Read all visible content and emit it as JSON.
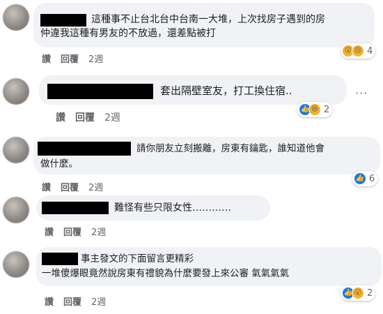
{
  "comments": [
    {
      "text_line1": "這種事不止台北台中台南一大堆，上次找房子遇到的房",
      "text_line2": "仲違我這種有男友的不放過，還差點被打",
      "like_label": "讚",
      "reply_label": "回覆",
      "time": "2週",
      "reaction_count": "4",
      "reactions": [
        "wow-icon",
        "sad-icon"
      ]
    },
    {
      "text_line1": "套出隔壁室友，打工換住宿..",
      "like_label": "讚",
      "reply_label": "回覆",
      "time": "2週",
      "reaction_count": "2",
      "reactions": [
        "like-icon",
        "haha-icon"
      ]
    },
    {
      "text_line1": "請你朋友立刻搬離，房東有鑰匙，誰知道他會",
      "text_line2": "做什麼。",
      "like_label": "讚",
      "reply_label": "回覆",
      "time": "2週",
      "reaction_count": "6",
      "reactions": [
        "like-icon"
      ]
    },
    {
      "text_line1": "難怪有些只限女性…………",
      "like_label": "讚",
      "reply_label": "回覆",
      "time": "2週"
    },
    {
      "text_line1": "事主發文的下面留言更精彩",
      "text_line2": "一堆傻爆眼竟然說房東有禮貌為什麼要發上來公審 氣氣氣氣",
      "like_label": "讚",
      "reply_label": "回覆",
      "time": "2週",
      "reaction_count": "2",
      "reactions": [
        "like-icon",
        "wow-icon"
      ]
    }
  ],
  "more_options_glyph": "···",
  "colors": {
    "bubble": "#f0f2f5",
    "like": "#1877f2",
    "emoji": "#f7b125",
    "meta": "#65676b"
  }
}
